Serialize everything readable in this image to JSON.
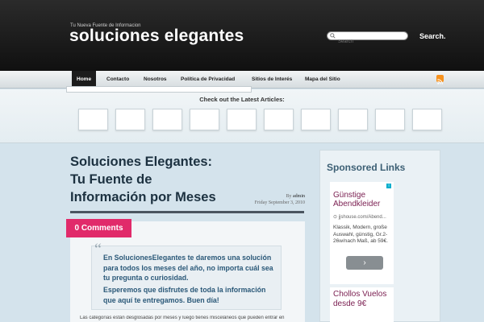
{
  "header": {
    "tagline": "Tu Nueva Fuente de Informacion",
    "site_title": "soluciones elegantes",
    "search_placeholder": "Search",
    "search_button": "Search."
  },
  "nav": {
    "items": [
      "Home",
      "Contacto",
      "Nosotros",
      "Política de Privacidad",
      "Sitios de Interés",
      "Mapa del Sitio"
    ]
  },
  "latest": {
    "title": "Check out the Latest Articles:"
  },
  "post": {
    "title_line1": "Soluciones Elegantes:",
    "title_line2": "Tu Fuente de",
    "title_line3": "Información por Meses",
    "by_label": "By",
    "author": "admin",
    "date": "Friday September 3, 2010",
    "comments": "0 Comments",
    "quote_p1": "En SolucionesElegantes te daremos una solución para todos los meses del año, no importa cuál sea tu pregunta o curiosidad.",
    "quote_p2": "Esperemos que disfrutes de toda la información que aquí te entregamos. Buen día!",
    "excerpt": "Las categorías están desglosadas por meses y luego tienes misceláneos que pueden entrar en"
  },
  "sidebar": {
    "title": "Sponsored Links",
    "ad1": {
      "title": "Günstige Abendkleider",
      "url": "jjshouse.com/Abend...",
      "text": "Klassik, Modern, große Auswahl, günstig, Gr.2-26w/nach Maß, ab 59€.",
      "arrow": "›"
    },
    "ad2": {
      "title": "Chollos Vuelos desde 9€"
    }
  },
  "colors": {
    "accent": "#e12a6a",
    "header_bg": "#1a1a1a",
    "title_color": "#1c3140",
    "quote_text": "#2a5878"
  }
}
